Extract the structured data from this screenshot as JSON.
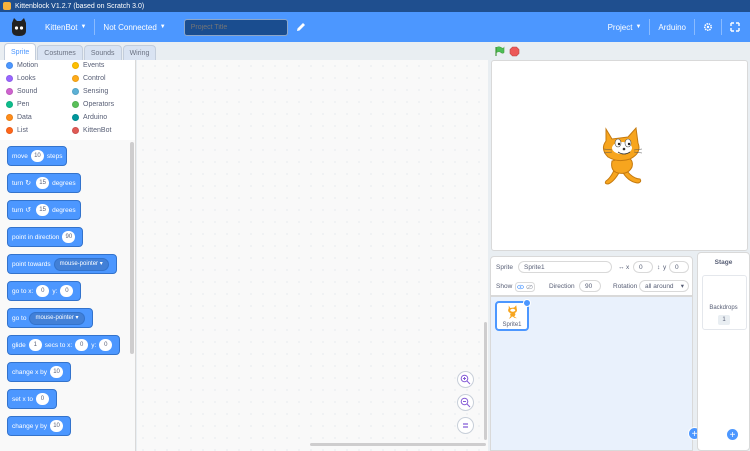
{
  "window": {
    "title": "Kittenblock V1.2.7 (based on Scratch 3.0)"
  },
  "menubar": {
    "brand": "KittenBot",
    "connection": "Not Connected",
    "project_title_placeholder": "Project Title",
    "project_menu": "Project",
    "board": "Arduino"
  },
  "tabs": [
    "Sprite",
    "Costumes",
    "Sounds",
    "Wiring"
  ],
  "categories": [
    {
      "label": "Motion",
      "color": "#4c97ff"
    },
    {
      "label": "Events",
      "color": "#ffbf00"
    },
    {
      "label": "Looks",
      "color": "#9966ff"
    },
    {
      "label": "Control",
      "color": "#ffab19"
    },
    {
      "label": "Sound",
      "color": "#cf63cf"
    },
    {
      "label": "Sensing",
      "color": "#5cb1d6"
    },
    {
      "label": "Pen",
      "color": "#0fbd8c"
    },
    {
      "label": "Operators",
      "color": "#59c059"
    },
    {
      "label": "Data",
      "color": "#ff8c1a"
    },
    {
      "label": "Arduino",
      "color": "#00979c"
    },
    {
      "label": "List",
      "color": "#ff661a"
    },
    {
      "label": "KittenBot",
      "color": "#e05a55"
    }
  ],
  "blocks": {
    "move": {
      "pre": "move",
      "val": "10",
      "post": "steps"
    },
    "turn_right": {
      "pre": "turn",
      "val": "15",
      "post": "degrees"
    },
    "turn_left": {
      "pre": "turn",
      "val": "15",
      "post": "degrees"
    },
    "point_direction": {
      "pre": "point in direction",
      "val": "90"
    },
    "point_towards": {
      "pre": "point towards",
      "dd": "mouse-pointer"
    },
    "goto_xy": {
      "pre": "go to x:",
      "x": "0",
      "y_label": "y:",
      "y": "0"
    },
    "goto": {
      "pre": "go to",
      "dd": "mouse-pointer"
    },
    "glide": {
      "pre": "glide",
      "secs": "1",
      "mid": "secs to x:",
      "x": "0",
      "y_label": "y:",
      "y": "0"
    },
    "change_x": {
      "pre": "change x by",
      "val": "10"
    },
    "set_x": {
      "pre": "set x to",
      "val": "0"
    },
    "change_y": {
      "pre": "change y by",
      "val": "10"
    }
  },
  "sprite_info": {
    "sprite_label": "Sprite",
    "sprite_name": "Sprite1",
    "x_label": "x",
    "x": "0",
    "y_label": "y",
    "y": "0",
    "show_label": "Show",
    "direction_label": "Direction",
    "direction": "90",
    "rotation_label": "Rotation",
    "rotation": "all around"
  },
  "sprite_list": [
    {
      "name": "Sprite1"
    }
  ],
  "stage_pane": {
    "title": "Stage",
    "backdrops_label": "Backdrops",
    "backdrops_count": "1"
  },
  "colors": {
    "accent": "#4c97ff",
    "motion_block": "#4c97ff",
    "titlebar": "#1f4f8f"
  }
}
